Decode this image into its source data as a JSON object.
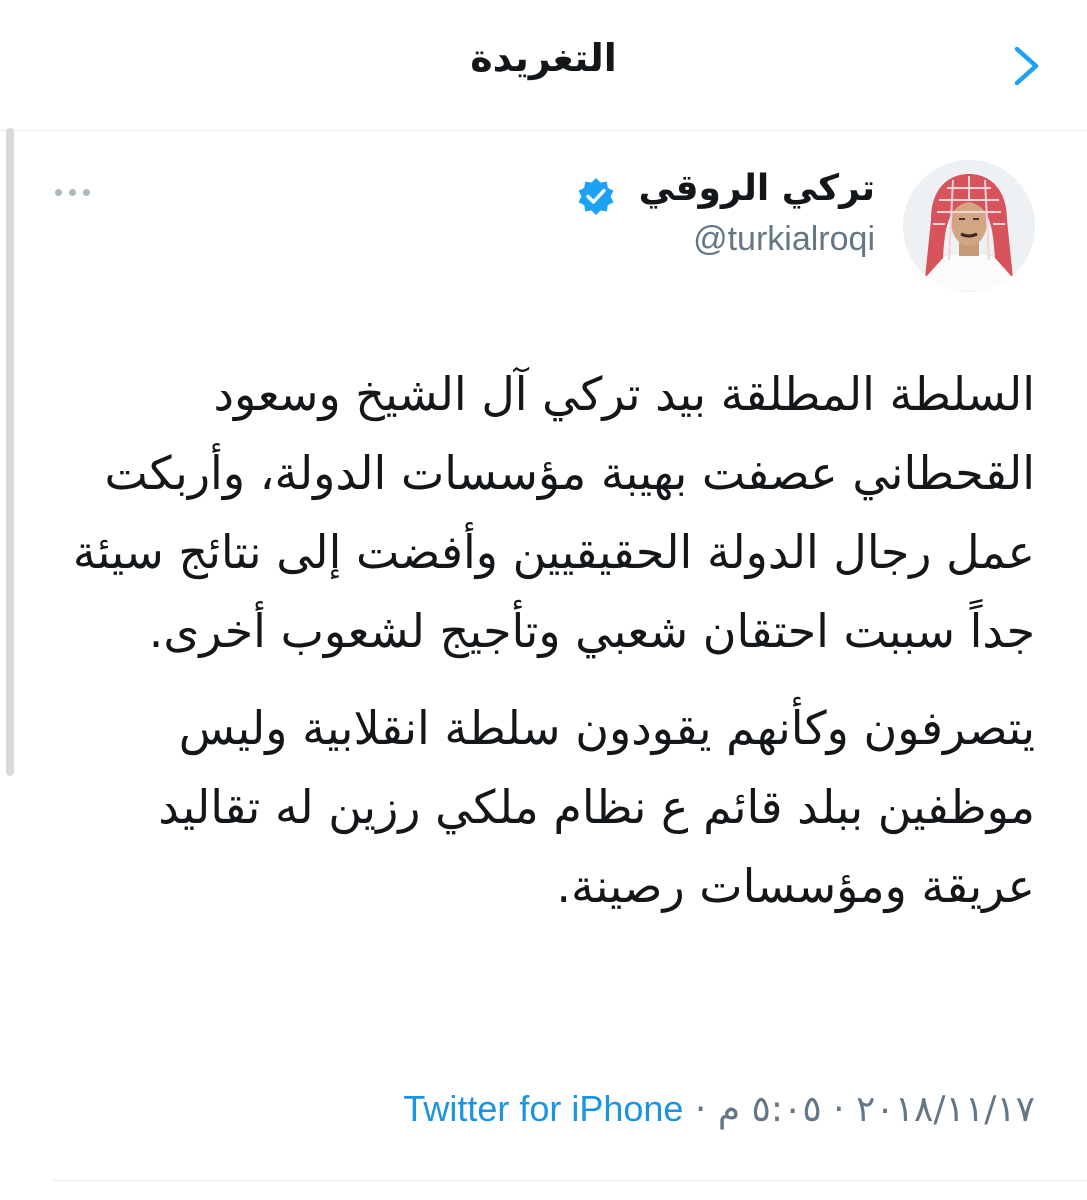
{
  "header": {
    "title": "التغريدة"
  },
  "tweet": {
    "author_name": "تركي الروقي",
    "handle": "@turkialroqi",
    "paragraphs": [
      "السلطة المطلقة بيد تركي آل الشيخ وسعود القحطاني عصفت بهيبة مؤسسات الدولة، وأربكت عمل رجال الدولة الحقيقيين وأفضت إلى نتائج سيئة جداً سببت احتقان شعبي وتأجيج لشعوب أخرى.",
      "يتصرفون وكأنهم يقودون سلطة انقلابية وليس موظفين ببلد قائم ع نظام ملكي رزين له تقاليد عريقة ومؤسسات رصينة."
    ],
    "date": "٢٠١٨/١١/١٧",
    "time": "٥:٠٥ م",
    "separator": "·",
    "source": "Twitter for iPhone"
  },
  "colors": {
    "accent": "#1b95e0",
    "secondary_text": "#657786",
    "divider": "#e6ecf0",
    "verified": "#1da1f2"
  },
  "icons": {
    "back": "chevron-right-icon",
    "verified": "verified-badge-icon",
    "more": "more-options-icon"
  }
}
